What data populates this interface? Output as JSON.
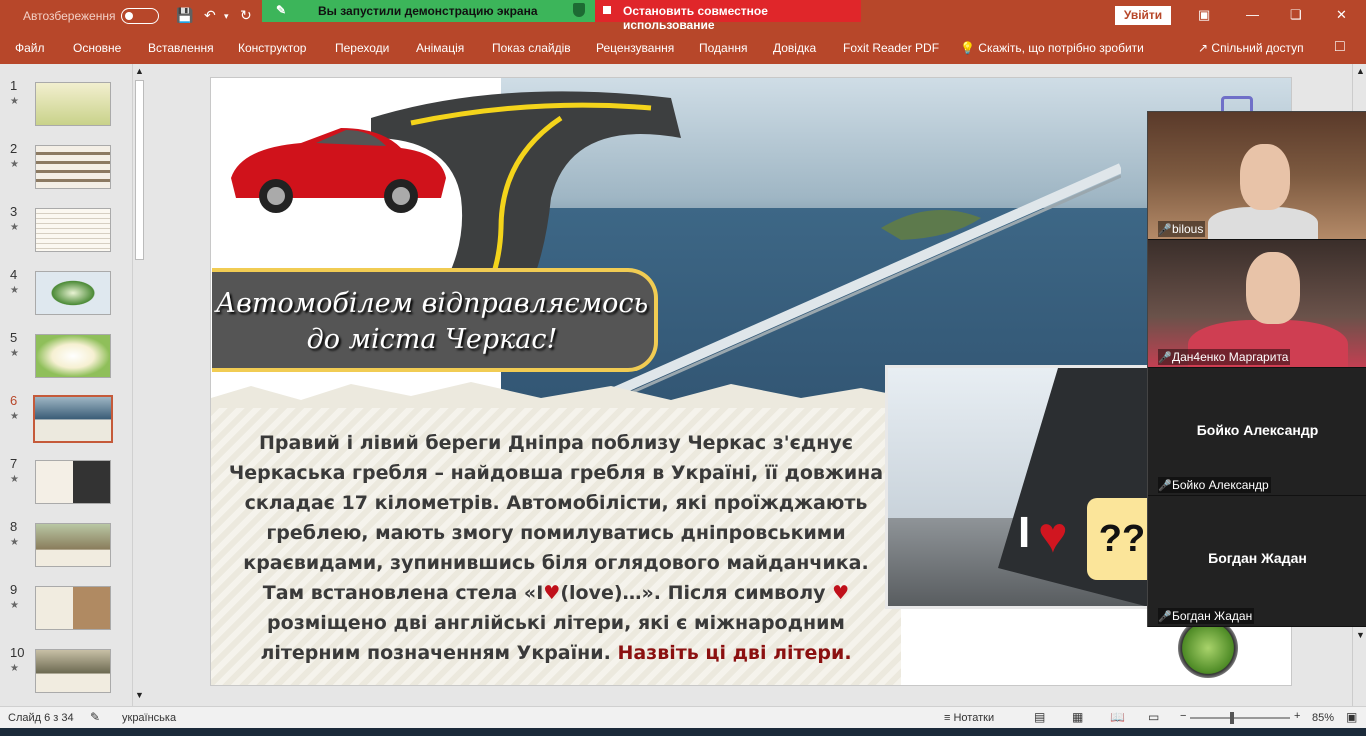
{
  "titlebar": {
    "autosave_label": "Автозбереження",
    "share_banner": "Вы запустили демонстрацию экрана",
    "stop_share": "Остановить совместное использование",
    "signin": "Увійти"
  },
  "ribbon": {
    "tabs": [
      "Файл",
      "Основне",
      "Вставлення",
      "Конструктор",
      "Переходи",
      "Анімація",
      "Показ слайдів",
      "Рецензування",
      "Подання",
      "Довідка",
      "Foxit Reader PDF"
    ],
    "tell_me": "Скажіть, що потрібно зробити",
    "share": "Спільний доступ"
  },
  "thumbnails": {
    "numbers": [
      "1",
      "2",
      "3",
      "4",
      "5",
      "6",
      "7",
      "8",
      "9",
      "10"
    ],
    "selected_index": 6
  },
  "slide": {
    "title_line1": "Автомобілем відправляємось",
    "title_line2": "до міста Черкас!",
    "body_part1": "Правий і лівий береги Дніпра поблизу Черкас з'єднує Черкаська гребля – найдовша гребля в Україні, її довжина складає 17 кілометрів. Автомобілісти, які проїжджають греблею, мають змогу помилуватись дніпровськими краєвидами, зупинившись біля оглядового майданчика. Там встановлена стела «I",
    "body_part2": "(love)…». Після символу ",
    "body_part3": " розміщено дві англійські літери, які є міжнародним літерним позначенням України.",
    "body_question": "Назвіть ці дві літери.",
    "photo_text": "I",
    "question_marks": "??"
  },
  "video": {
    "participants": [
      {
        "name": "bilous"
      },
      {
        "name": "Дан4енко Маргарита"
      },
      {
        "name": "Бойко Александр",
        "label": "Бойко Александр"
      },
      {
        "name": "Богдан Жадан",
        "label": "Богдан Жадан"
      }
    ]
  },
  "status": {
    "slide_counter": "Слайд 6 з 34",
    "language": "українська",
    "notes": "Нотатки",
    "zoom": "85%"
  },
  "colors": {
    "accent": "#b7472a",
    "share_green": "#3cb55a",
    "stop_red": "#e0262a"
  }
}
